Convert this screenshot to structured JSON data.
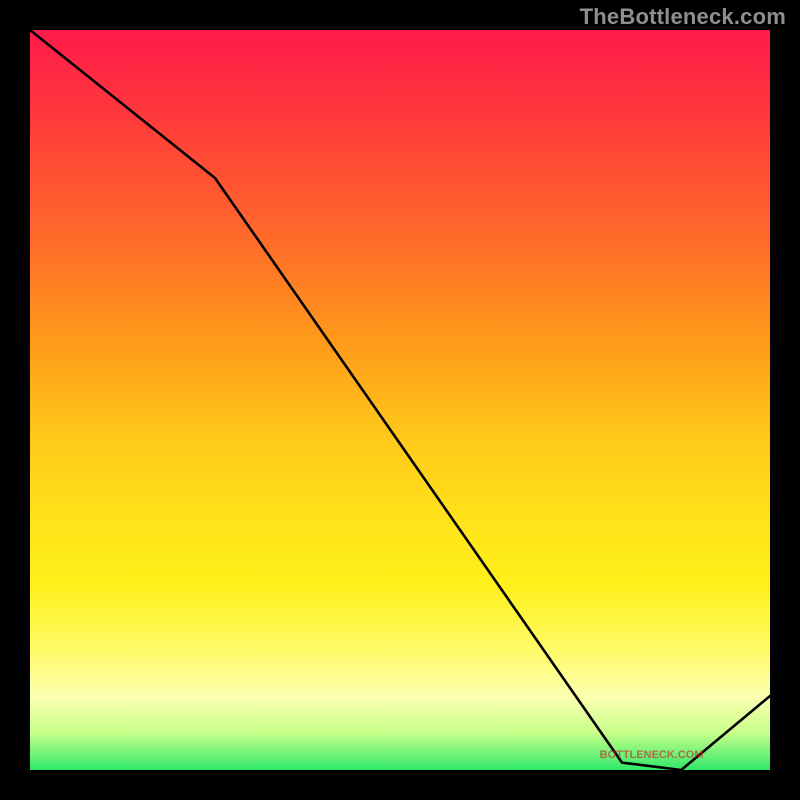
{
  "attribution": "TheBottleneck.com",
  "watermark": "BOTTLENECK.COM",
  "chart_data": {
    "type": "line",
    "title": "",
    "xlabel": "",
    "ylabel": "",
    "xlim": [
      0,
      100
    ],
    "ylim": [
      0,
      100
    ],
    "x": [
      0,
      25,
      80,
      88,
      100
    ],
    "values": [
      100,
      80,
      1,
      0,
      10
    ],
    "grid": false,
    "legend": false,
    "background_gradient": {
      "orientation": "vertical",
      "stops": [
        {
          "pct": 0,
          "color": "#ff1a4b"
        },
        {
          "pct": 12,
          "color": "#ff3a3a"
        },
        {
          "pct": 28,
          "color": "#ff6a2a"
        },
        {
          "pct": 42,
          "color": "#ff9a1a"
        },
        {
          "pct": 55,
          "color": "#ffc81a"
        },
        {
          "pct": 66,
          "color": "#ffe21a"
        },
        {
          "pct": 75,
          "color": "#fff01a"
        },
        {
          "pct": 84,
          "color": "#fffb6a"
        },
        {
          "pct": 90,
          "color": "#fdffb0"
        },
        {
          "pct": 95,
          "color": "#c8ff8a"
        },
        {
          "pct": 100,
          "color": "#2ee86a"
        }
      ]
    },
    "watermark_position": {
      "x": 84,
      "y": 2
    }
  }
}
